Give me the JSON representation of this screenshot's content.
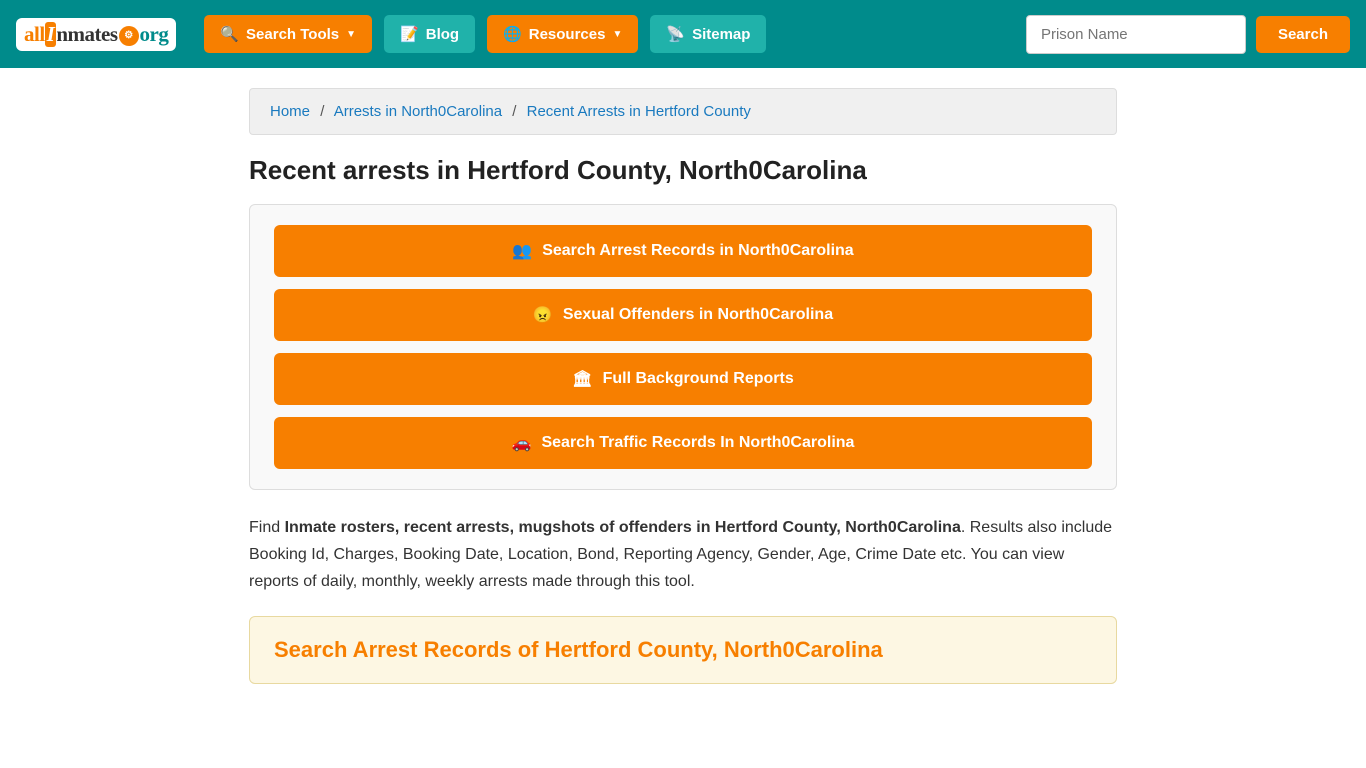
{
  "navbar": {
    "logo": {
      "text_all": "all",
      "text_i": "I",
      "text_nmates": "nmates",
      "text_dot": "·",
      "text_org": "org"
    },
    "search_tools_label": "Search Tools",
    "blog_label": "Blog",
    "resources_label": "Resources",
    "sitemap_label": "Sitemap",
    "prison_name_placeholder": "Prison Name",
    "search_button_label": "Search"
  },
  "breadcrumb": {
    "home_label": "Home",
    "arrests_label": "Arrests in North0Carolina",
    "current_label": "Recent Arrests in Hertford County"
  },
  "page": {
    "title": "Recent arrests in Hertford County, North0Carolina",
    "card": {
      "btn1_label": "Search Arrest Records in North0Carolina",
      "btn2_label": "Sexual Offenders in North0Carolina",
      "btn3_label": "Full Background Reports",
      "btn4_label": "Search Traffic Records In North0Carolina"
    },
    "description_intro": "Find ",
    "description_bold1": "Inmate rosters, recent arrests, mugshots of offenders in Hertford County, North0Carolina",
    "description_rest": ". Results also include Booking Id, Charges, Booking Date, Location, Bond, Reporting Agency, Gender, Age, Crime Date etc. You can view reports of daily, monthly, weekly arrests made through this tool.",
    "search_section_title": "Search Arrest Records of Hertford County, North0Carolina"
  }
}
